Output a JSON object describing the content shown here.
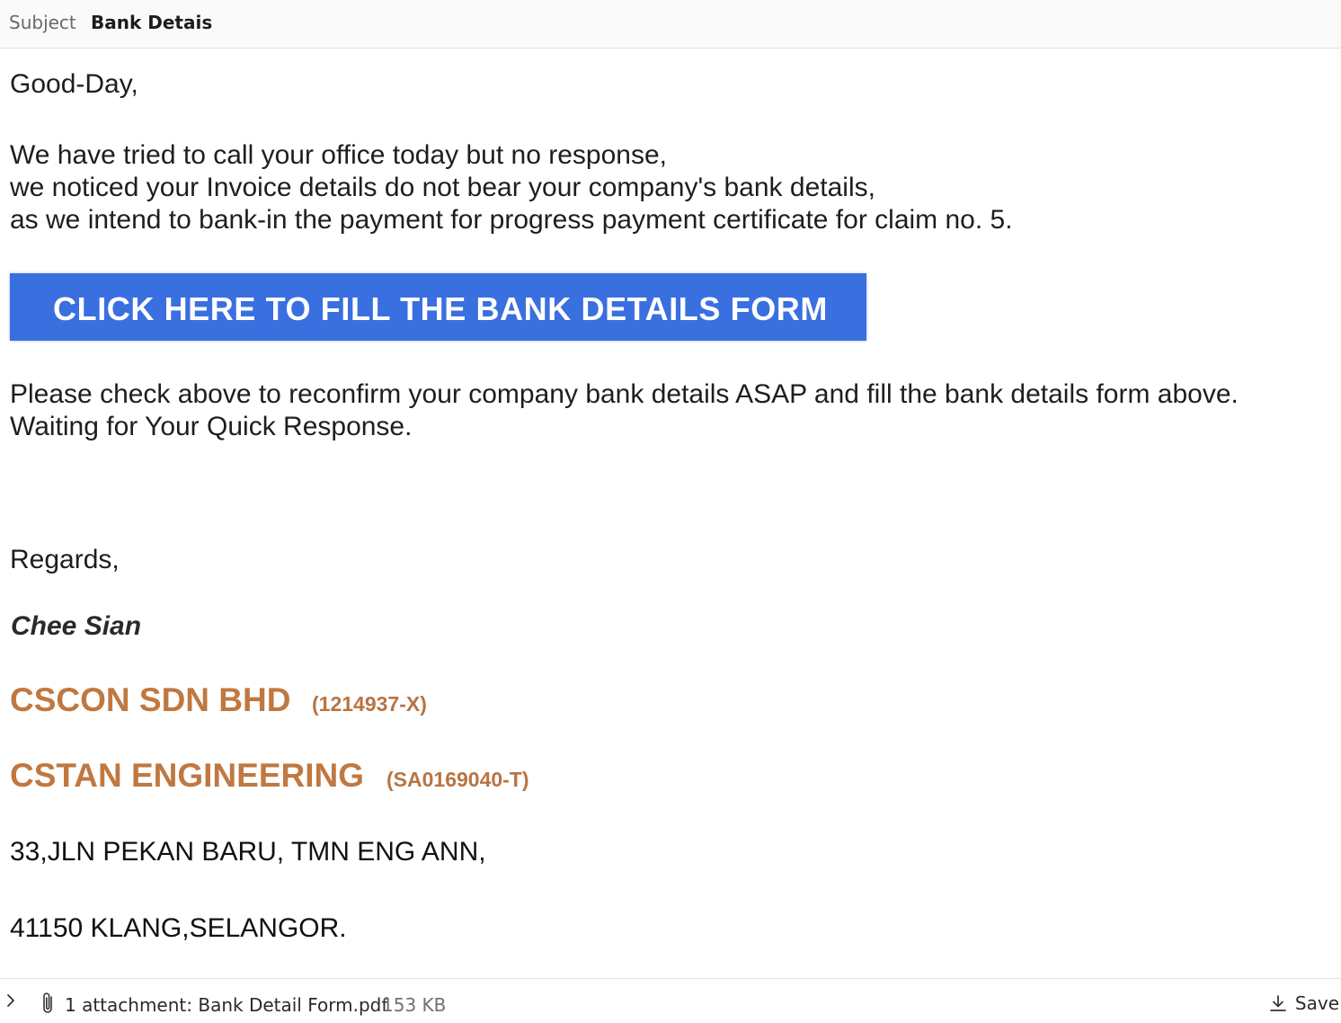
{
  "header": {
    "subject_label": "Subject",
    "subject_value": "Bank Detais"
  },
  "body": {
    "greeting": "Good-Day,",
    "paragraph1": [
      "We have tried to call your office today but no response,",
      "we noticed your Invoice details do not bear your company's bank details,",
      "as we intend to bank-in the payment for progress payment certificate for claim no. 5."
    ],
    "cta_label": "CLICK HERE TO FILL THE BANK DETAILS FORM",
    "paragraph2": [
      "Please check above to reconfirm your company bank details ASAP and fill the bank details form above.",
      "Waiting for Your Quick Response."
    ],
    "regards": "Regards,"
  },
  "signature": {
    "name": "Chee Sian",
    "company1": "CSCON SDN BHD",
    "company1_reg": "(1214937-X)",
    "company2": "CSTAN ENGINEERING",
    "company2_reg": "(SA0169040-T)",
    "address_line1": "33,JLN PEKAN BARU, TMN ENG ANN,",
    "address_line2": "41150 KLANG,SELANGOR."
  },
  "footer": {
    "expand_icon": "chevron-right-icon",
    "attachment_icon": "paperclip-icon",
    "attachment_text": "1 attachment: Bank Detail Form.pdf",
    "attachment_size": "153 KB",
    "save_icon": "download-icon",
    "save_label": "Save"
  },
  "colors": {
    "cta_background": "#3a6fe0",
    "company_text": "#c07840"
  }
}
